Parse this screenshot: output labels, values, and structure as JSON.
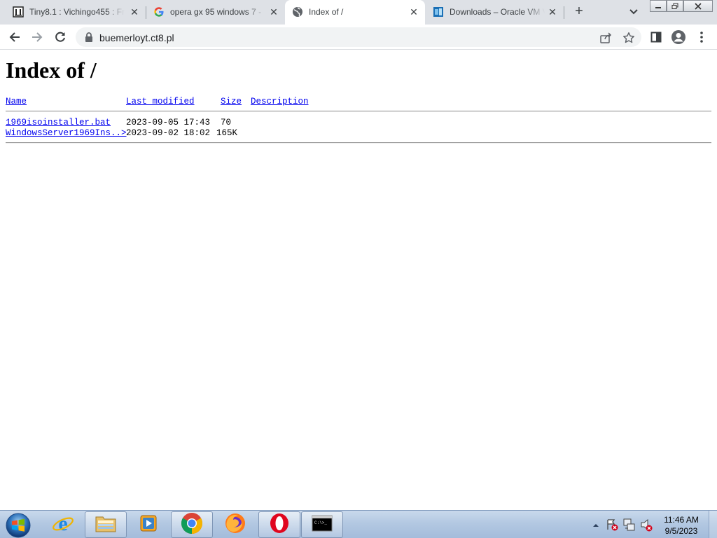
{
  "browser": {
    "tabs": [
      {
        "title": "Tiny8.1 : Vichingo455 : Fr",
        "active": false,
        "favicon": "archive-org-icon"
      },
      {
        "title": "opera gx 95 windows 7 -",
        "active": false,
        "favicon": "google-g-icon"
      },
      {
        "title": "Index of /",
        "active": true,
        "favicon": "globe-icon"
      },
      {
        "title": "Downloads – Oracle VM V",
        "active": false,
        "favicon": "virtualbox-icon"
      }
    ],
    "address": "buemerloyt.ct8.pl"
  },
  "page": {
    "title": "Index of /",
    "columns": {
      "name": "Name",
      "modified": "Last modified",
      "size": "Size",
      "description": "Description"
    },
    "rows": [
      {
        "name": "1969isoinstaller.bat",
        "modified": "2023-09-05 17:43",
        "size": "70"
      },
      {
        "name": "WindowsServer1969Ins..>",
        "modified": "2023-09-02 18:02",
        "size": "165K"
      }
    ]
  },
  "taskbar": {
    "apps": [
      "internet-explorer-icon",
      "file-explorer-icon",
      "media-player-icon",
      "chrome-icon",
      "firefox-icon",
      "opera-icon",
      "command-prompt-icon"
    ],
    "time": "11:46 AM",
    "date": "9/5/2023"
  }
}
